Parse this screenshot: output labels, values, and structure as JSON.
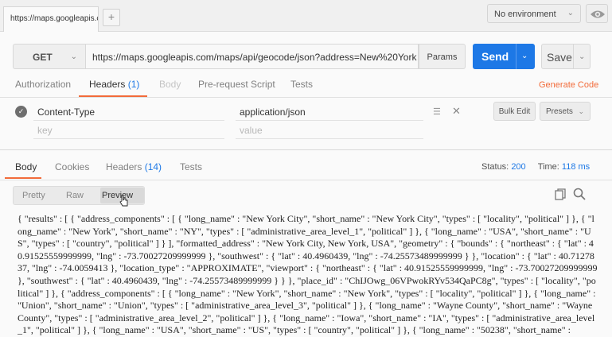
{
  "tabs": {
    "active_tab_title": "https://maps.googleapis.c",
    "add_tab": "+"
  },
  "environment": {
    "selected": "No environment"
  },
  "request": {
    "method": "GET",
    "url": "https://maps.googleapis.com/maps/api/geocode/json?address=New%20York",
    "params_label": "Params",
    "send_label": "Send",
    "save_label": "Save"
  },
  "request_tabs": {
    "authorization": "Authorization",
    "headers": "Headers",
    "headers_count": "(1)",
    "body": "Body",
    "pre_request": "Pre-request Script",
    "tests": "Tests",
    "generate_code": "Generate Code"
  },
  "headers_table": {
    "rows": [
      {
        "key": "Content-Type",
        "value": "application/json"
      }
    ],
    "key_placeholder": "key",
    "value_placeholder": "value",
    "bulk_edit": "Bulk Edit",
    "presets": "Presets"
  },
  "response_tabs": {
    "body": "Body",
    "cookies": "Cookies",
    "headers": "Headers",
    "headers_count": "(14)",
    "tests": "Tests",
    "status_label": "Status:",
    "status_value": "200",
    "time_label": "Time:",
    "time_value": "118 ms"
  },
  "view_modes": {
    "pretty": "Pretty",
    "raw": "Raw",
    "preview": "Preview"
  },
  "response_body": "{ \"results\" : [ { \"address_components\" : [ { \"long_name\" : \"New York City\", \"short_name\" : \"New York City\", \"types\" : [ \"locality\", \"political\" ] }, { \"long_name\" : \"New York\", \"short_name\" : \"NY\", \"types\" : [ \"administrative_area_level_1\", \"political\" ] }, { \"long_name\" : \"USA\", \"short_name\" : \"US\", \"types\" : [ \"country\", \"political\" ] } ], \"formatted_address\" : \"New York City, New York, USA\", \"geometry\" : { \"bounds\" : { \"northeast\" : { \"lat\" : 40.91525559999999, \"lng\" : -73.70027209999999 }, \"southwest\" : { \"lat\" : 40.4960439, \"lng\" : -74.25573489999999 } }, \"location\" : { \"lat\" : 40.7127837, \"lng\" : -74.0059413 }, \"location_type\" : \"APPROXIMATE\", \"viewport\" : { \"northeast\" : { \"lat\" : 40.91525559999999, \"lng\" : -73.70027209999999 }, \"southwest\" : { \"lat\" : 40.4960439, \"lng\" : -74.25573489999999 } } }, \"place_id\" : \"ChIJOwg_06VPwokRYv534QaPC8g\", \"types\" : [ \"locality\", \"political\" ] }, { \"address_components\" : [ { \"long_name\" : \"New York\", \"short_name\" : \"New York\", \"types\" : [ \"locality\", \"political\" ] }, { \"long_name\" : \"Union\", \"short_name\" : \"Union\", \"types\" : [ \"administrative_area_level_3\", \"political\" ] }, { \"long_name\" : \"Wayne County\", \"short_name\" : \"Wayne County\", \"types\" : [ \"administrative_area_level_2\", \"political\" ] }, { \"long_name\" : \"Iowa\", \"short_name\" : \"IA\", \"types\" : [ \"administrative_area_level_1\", \"political\" ] }, { \"long_name\" : \"USA\", \"short_name\" : \"US\", \"types\" : [ \"country\", \"political\" ] }, { \"long_name\" : \"50238\", \"short_name\" :",
  "colors": {
    "accent": "#1d78e6",
    "highlight": "#f26b3a"
  },
  "icons": [
    "eye-icon",
    "chevron-down-icon",
    "checkmark-icon",
    "menu-icon",
    "close-icon",
    "copy-icon",
    "search-icon",
    "cursor-icon"
  ]
}
